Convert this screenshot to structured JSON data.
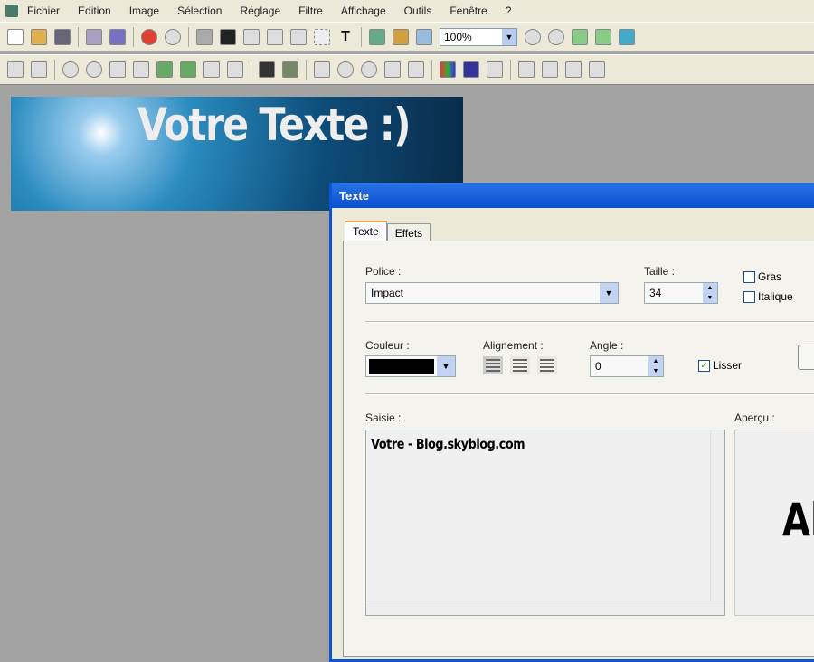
{
  "menu": [
    "Fichier",
    "Edition",
    "Image",
    "Sélection",
    "Réglage",
    "Filtre",
    "Affichage",
    "Outils",
    "Fenêtre",
    "?"
  ],
  "toolbar": {
    "zoom": "100%"
  },
  "canvas": {
    "banner_text": "Votre Texte :)"
  },
  "dialog": {
    "title": "Texte",
    "tabs": [
      "Texte",
      "Effets"
    ],
    "font_label": "Police :",
    "font_value": "Impact",
    "size_label": "Taille :",
    "size_value": "34",
    "bold_label": "Gras",
    "italic_label": "Italique",
    "color_label": "Couleur :",
    "color_value": "#000000",
    "align_label": "Alignement :",
    "angle_label": "Angle :",
    "angle_value": "0",
    "smooth_label": "Lisser",
    "input_label": "Saisie :",
    "input_value": "Votre - Blog.skyblog.com",
    "preview_label": "Aperçu :",
    "preview_text": "Al"
  }
}
